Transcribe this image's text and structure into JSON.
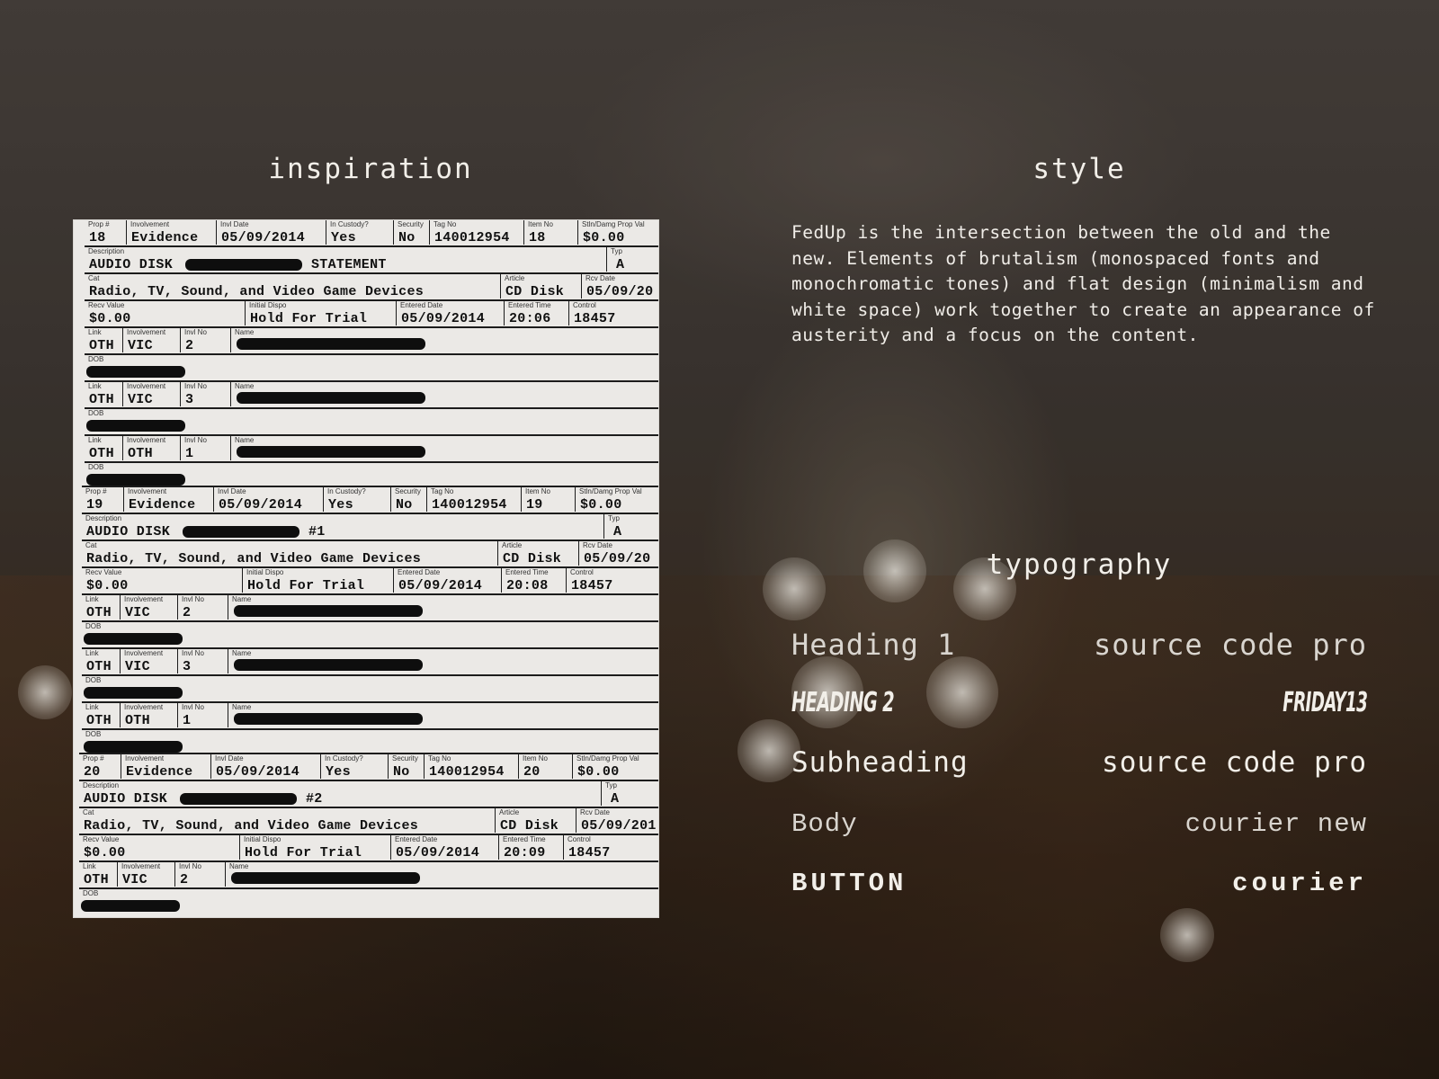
{
  "headings": {
    "inspiration": "inspiration",
    "style": "style",
    "typography": "typography"
  },
  "style_text": "FedUp is the intersection between the old and the new. Elements of brutalism (monospaced fonts and monochromatic tones) and flat design (minimalism and white space) work together to create an appearance of austerity and a focus on the content.",
  "typography": [
    {
      "role": "Heading 1",
      "font": "source code pro"
    },
    {
      "role": "HEADING 2",
      "font": "FRIDAY13"
    },
    {
      "role": "Subheading",
      "font": "source code pro"
    },
    {
      "role": "Body",
      "font": "courier new"
    },
    {
      "role": "BUTTON",
      "font": "courier"
    }
  ],
  "form_labels": {
    "prop": "Prop #",
    "involvement": "Involvement",
    "invl_date": "Invl Date",
    "in_custody": "In Custody?",
    "security": "Security",
    "tag_no": "Tag No",
    "item_no": "Item No",
    "stln": "Stln/Damg Prop Val",
    "description": "Description",
    "typ": "Typ",
    "cat": "Cat",
    "article": "Article",
    "rcv_date": "Rcv Date",
    "recv_value": "Recv Value",
    "initial_dispo": "Initial Dispo",
    "entered_date": "Entered Date",
    "entered_time": "Entered Time",
    "control": "Control",
    "link": "Link",
    "invl_no": "Invl No",
    "name": "Name",
    "dob": "DOB"
  },
  "form_records": [
    {
      "prop": "18",
      "involvement": "Evidence",
      "invl_date": "05/09/2014",
      "in_custody": "Yes",
      "security": "No",
      "tag_no": "140012954",
      "item_no": "18",
      "stln": "$0.00",
      "description_start": "AUDIO DISK",
      "description_end": "STATEMENT",
      "typ": "A",
      "cat": "Radio, TV, Sound, and Video Game Devices",
      "article": "CD Disk",
      "rcv_date": "05/09/20",
      "recv_value": "$0.00",
      "initial_dispo": "Hold For Trial",
      "entered_date": "05/09/2014",
      "entered_time": "20:06",
      "control": "18457",
      "links": [
        {
          "link": "OTH",
          "involvement": "VIC",
          "invl_no": "2"
        },
        {
          "link": "OTH",
          "involvement": "VIC",
          "invl_no": "3"
        },
        {
          "link": "OTH",
          "involvement": "OTH",
          "invl_no": "1"
        }
      ]
    },
    {
      "prop": "19",
      "involvement": "Evidence",
      "invl_date": "05/09/2014",
      "in_custody": "Yes",
      "security": "No",
      "tag_no": "140012954",
      "item_no": "19",
      "stln": "$0.00",
      "description_start": "AUDIO DISK",
      "description_end": "#1",
      "typ": "A",
      "cat": "Radio, TV, Sound, and Video Game Devices",
      "article": "CD Disk",
      "rcv_date": "05/09/20",
      "recv_value": "$0.00",
      "initial_dispo": "Hold For Trial",
      "entered_date": "05/09/2014",
      "entered_time": "20:08",
      "control": "18457",
      "links": [
        {
          "link": "OTH",
          "involvement": "VIC",
          "invl_no": "2"
        },
        {
          "link": "OTH",
          "involvement": "VIC",
          "invl_no": "3"
        },
        {
          "link": "OTH",
          "involvement": "OTH",
          "invl_no": "1"
        }
      ]
    },
    {
      "prop": "20",
      "involvement": "Evidence",
      "invl_date": "05/09/2014",
      "in_custody": "Yes",
      "security": "No",
      "tag_no": "140012954",
      "item_no": "20",
      "stln": "$0.00",
      "description_start": "AUDIO DISK",
      "description_end": "#2",
      "typ": "A",
      "cat": "Radio, TV, Sound, and Video Game Devices",
      "article": "CD Disk",
      "rcv_date": "05/09/201",
      "recv_value": "$0.00",
      "initial_dispo": "Hold For Trial",
      "entered_date": "05/09/2014",
      "entered_time": "20:09",
      "control": "18457",
      "links": [
        {
          "link": "OTH",
          "involvement": "VIC",
          "invl_no": "2"
        }
      ]
    }
  ]
}
